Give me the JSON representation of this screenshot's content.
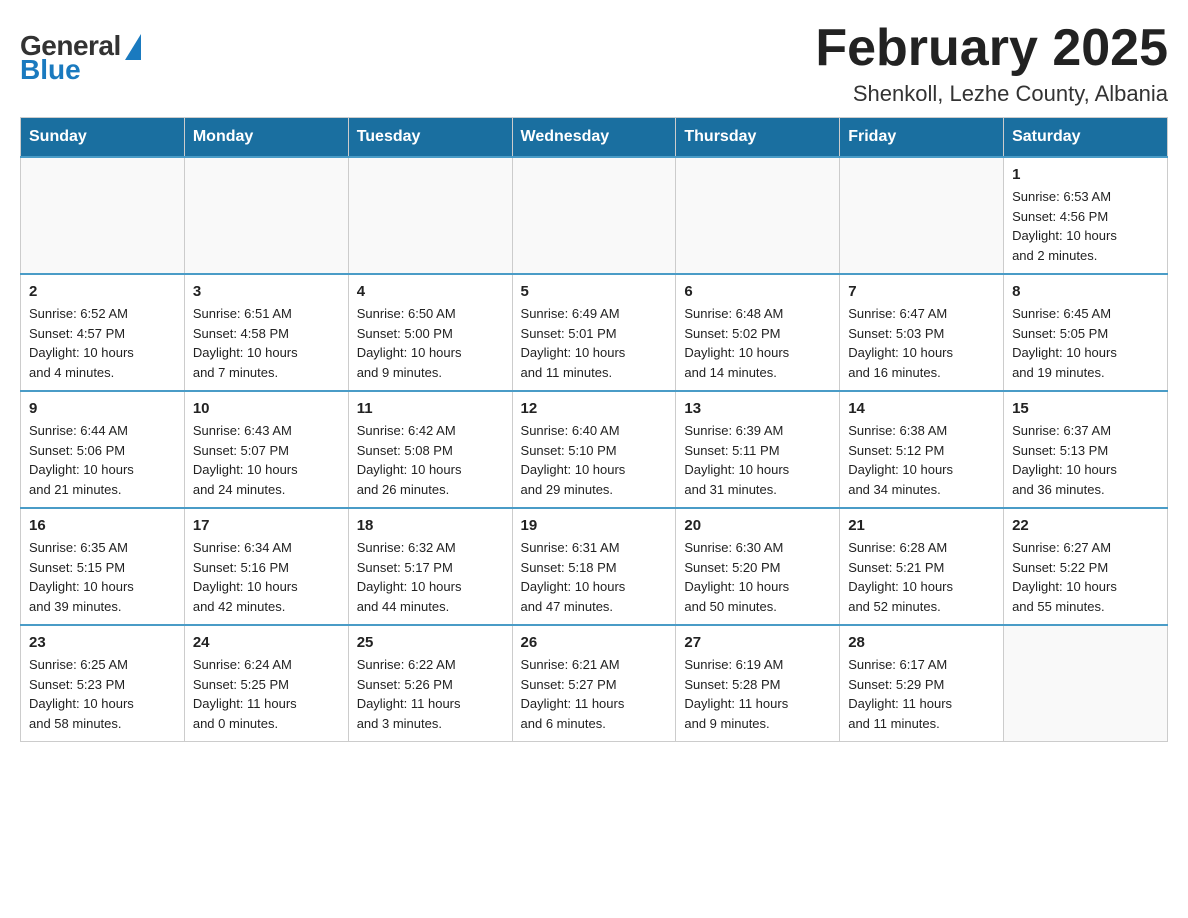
{
  "logo": {
    "general": "General",
    "blue": "Blue"
  },
  "title": "February 2025",
  "subtitle": "Shenkoll, Lezhe County, Albania",
  "days_of_week": [
    "Sunday",
    "Monday",
    "Tuesday",
    "Wednesday",
    "Thursday",
    "Friday",
    "Saturday"
  ],
  "weeks": [
    [
      {
        "day": "",
        "info": ""
      },
      {
        "day": "",
        "info": ""
      },
      {
        "day": "",
        "info": ""
      },
      {
        "day": "",
        "info": ""
      },
      {
        "day": "",
        "info": ""
      },
      {
        "day": "",
        "info": ""
      },
      {
        "day": "1",
        "info": "Sunrise: 6:53 AM\nSunset: 4:56 PM\nDaylight: 10 hours\nand 2 minutes."
      }
    ],
    [
      {
        "day": "2",
        "info": "Sunrise: 6:52 AM\nSunset: 4:57 PM\nDaylight: 10 hours\nand 4 minutes."
      },
      {
        "day": "3",
        "info": "Sunrise: 6:51 AM\nSunset: 4:58 PM\nDaylight: 10 hours\nand 7 minutes."
      },
      {
        "day": "4",
        "info": "Sunrise: 6:50 AM\nSunset: 5:00 PM\nDaylight: 10 hours\nand 9 minutes."
      },
      {
        "day": "5",
        "info": "Sunrise: 6:49 AM\nSunset: 5:01 PM\nDaylight: 10 hours\nand 11 minutes."
      },
      {
        "day": "6",
        "info": "Sunrise: 6:48 AM\nSunset: 5:02 PM\nDaylight: 10 hours\nand 14 minutes."
      },
      {
        "day": "7",
        "info": "Sunrise: 6:47 AM\nSunset: 5:03 PM\nDaylight: 10 hours\nand 16 minutes."
      },
      {
        "day": "8",
        "info": "Sunrise: 6:45 AM\nSunset: 5:05 PM\nDaylight: 10 hours\nand 19 minutes."
      }
    ],
    [
      {
        "day": "9",
        "info": "Sunrise: 6:44 AM\nSunset: 5:06 PM\nDaylight: 10 hours\nand 21 minutes."
      },
      {
        "day": "10",
        "info": "Sunrise: 6:43 AM\nSunset: 5:07 PM\nDaylight: 10 hours\nand 24 minutes."
      },
      {
        "day": "11",
        "info": "Sunrise: 6:42 AM\nSunset: 5:08 PM\nDaylight: 10 hours\nand 26 minutes."
      },
      {
        "day": "12",
        "info": "Sunrise: 6:40 AM\nSunset: 5:10 PM\nDaylight: 10 hours\nand 29 minutes."
      },
      {
        "day": "13",
        "info": "Sunrise: 6:39 AM\nSunset: 5:11 PM\nDaylight: 10 hours\nand 31 minutes."
      },
      {
        "day": "14",
        "info": "Sunrise: 6:38 AM\nSunset: 5:12 PM\nDaylight: 10 hours\nand 34 minutes."
      },
      {
        "day": "15",
        "info": "Sunrise: 6:37 AM\nSunset: 5:13 PM\nDaylight: 10 hours\nand 36 minutes."
      }
    ],
    [
      {
        "day": "16",
        "info": "Sunrise: 6:35 AM\nSunset: 5:15 PM\nDaylight: 10 hours\nand 39 minutes."
      },
      {
        "day": "17",
        "info": "Sunrise: 6:34 AM\nSunset: 5:16 PM\nDaylight: 10 hours\nand 42 minutes."
      },
      {
        "day": "18",
        "info": "Sunrise: 6:32 AM\nSunset: 5:17 PM\nDaylight: 10 hours\nand 44 minutes."
      },
      {
        "day": "19",
        "info": "Sunrise: 6:31 AM\nSunset: 5:18 PM\nDaylight: 10 hours\nand 47 minutes."
      },
      {
        "day": "20",
        "info": "Sunrise: 6:30 AM\nSunset: 5:20 PM\nDaylight: 10 hours\nand 50 minutes."
      },
      {
        "day": "21",
        "info": "Sunrise: 6:28 AM\nSunset: 5:21 PM\nDaylight: 10 hours\nand 52 minutes."
      },
      {
        "day": "22",
        "info": "Sunrise: 6:27 AM\nSunset: 5:22 PM\nDaylight: 10 hours\nand 55 minutes."
      }
    ],
    [
      {
        "day": "23",
        "info": "Sunrise: 6:25 AM\nSunset: 5:23 PM\nDaylight: 10 hours\nand 58 minutes."
      },
      {
        "day": "24",
        "info": "Sunrise: 6:24 AM\nSunset: 5:25 PM\nDaylight: 11 hours\nand 0 minutes."
      },
      {
        "day": "25",
        "info": "Sunrise: 6:22 AM\nSunset: 5:26 PM\nDaylight: 11 hours\nand 3 minutes."
      },
      {
        "day": "26",
        "info": "Sunrise: 6:21 AM\nSunset: 5:27 PM\nDaylight: 11 hours\nand 6 minutes."
      },
      {
        "day": "27",
        "info": "Sunrise: 6:19 AM\nSunset: 5:28 PM\nDaylight: 11 hours\nand 9 minutes."
      },
      {
        "day": "28",
        "info": "Sunrise: 6:17 AM\nSunset: 5:29 PM\nDaylight: 11 hours\nand 11 minutes."
      },
      {
        "day": "",
        "info": ""
      }
    ]
  ]
}
